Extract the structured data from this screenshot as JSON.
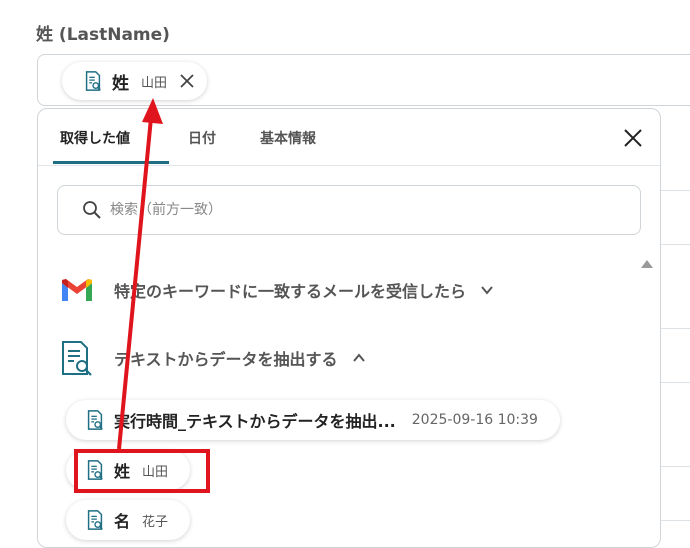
{
  "field": {
    "label": "姓 (LastName)",
    "chip": {
      "name": "姓",
      "value": "山田"
    }
  },
  "panel": {
    "tabs": [
      {
        "label": "取得した値",
        "active": true
      },
      {
        "label": "日付",
        "active": false
      },
      {
        "label": "基本情報",
        "active": false
      }
    ],
    "search_placeholder": "検索（前方一致）",
    "sections": [
      {
        "label": "特定のキーワードに一致するメールを受信したら",
        "icon": "gmail-icon",
        "state": "collapsed"
      },
      {
        "label": "テキストからデータを抽出する",
        "icon": "document-search-icon",
        "state": "expanded"
      }
    ],
    "items": [
      {
        "name": "実行時間_テキストからデータを抽出...",
        "value": "2025-09-16 10:39"
      },
      {
        "name": "姓",
        "value": "山田"
      },
      {
        "name": "名",
        "value": "花子"
      }
    ]
  },
  "colors": {
    "accent": "#1f6f84",
    "annotation": "#e0141c"
  }
}
